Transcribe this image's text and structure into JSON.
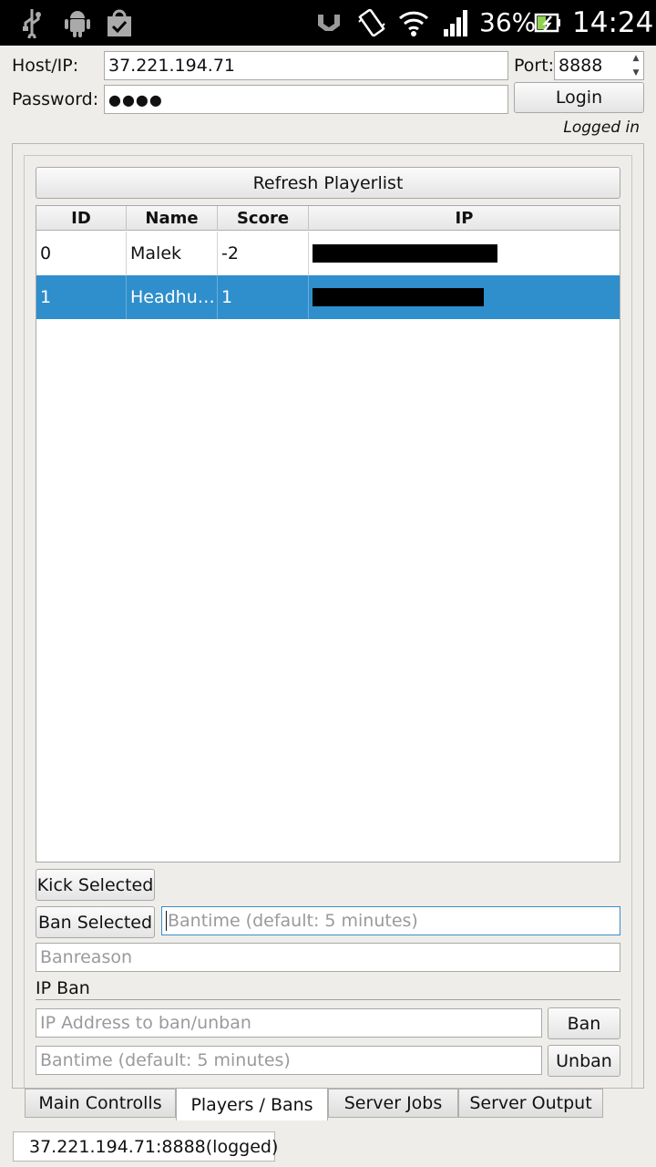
{
  "status_bar": {
    "icons": [
      "usb-icon",
      "android-debug-icon",
      "shopping-bag-icon",
      "nfc-icon",
      "vibrate-icon",
      "wifi-icon",
      "signal-icon",
      "battery-charging-icon"
    ],
    "battery": "36%",
    "clock": "14:24"
  },
  "connection": {
    "host_label": "Host/IP:",
    "host_value": "37.221.194.71",
    "port_label": "Port:",
    "port_value": "8888",
    "password_label": "Password:",
    "password_value": "●●●●",
    "login_label": "Login",
    "status": "Logged in"
  },
  "players": {
    "refresh_label": "Refresh Playerlist",
    "columns": [
      "ID",
      "Name",
      "Score",
      "IP"
    ],
    "rows": [
      {
        "id": "0",
        "name": "Malek",
        "score": "-2",
        "ip_redacted": true,
        "selected": false
      },
      {
        "id": "1",
        "name": "Headhu…",
        "score": "1",
        "ip_redacted": true,
        "selected": true
      }
    ],
    "kick_label": "Kick Selected",
    "ban_selected_label": "Ban Selected",
    "bantime_placeholder": "Bantime (default: 5 minutes)",
    "banreason_placeholder": "Banreason"
  },
  "ip_ban": {
    "section_label": "IP Ban",
    "ip_placeholder": "IP Address to ban/unban",
    "ban_label": "Ban",
    "bantime_placeholder": "Bantime (default: 5 minutes)",
    "unban_label": "Unban"
  },
  "tabs": [
    {
      "label": "Main Controlls",
      "active": false
    },
    {
      "label": "Players / Bans",
      "active": true
    },
    {
      "label": "Server Jobs",
      "active": false
    },
    {
      "label": "Server Output",
      "active": false
    }
  ],
  "footer": {
    "status": "37.221.194.71:8888(logged)"
  },
  "colors": {
    "selection": "#2f8ecc",
    "background": "#efede9",
    "focus_border": "#3b8fc6"
  }
}
